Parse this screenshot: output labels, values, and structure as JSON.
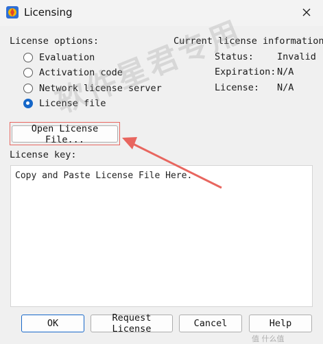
{
  "window": {
    "title": "Licensing",
    "close_icon": "close-icon",
    "app_icon": "app-logo-icon"
  },
  "license_options": {
    "heading": "License options:",
    "options": [
      {
        "label": "Evaluation",
        "selected": false
      },
      {
        "label": "Activation code",
        "selected": false
      },
      {
        "label": "Network license server",
        "selected": false
      },
      {
        "label": "License file",
        "selected": true
      }
    ]
  },
  "current_info": {
    "heading": "Current license information",
    "status_label": "Status:",
    "status_value": "Invalid",
    "expiration_label": "Expiration:",
    "expiration_value": "N/A",
    "license_label": "License:",
    "license_value": "N/A"
  },
  "open_file_button": "Open License File...",
  "license_key": {
    "label": "License key:",
    "value": "Copy and Paste License File Here."
  },
  "buttons": {
    "ok": "OK",
    "request": "Request License",
    "cancel": "Cancel",
    "help": "Help"
  },
  "watermark": "软件星君专用",
  "corner_watermark": "值 什么值",
  "colors": {
    "accent": "#1667c8",
    "annotation": "#e8665f"
  }
}
